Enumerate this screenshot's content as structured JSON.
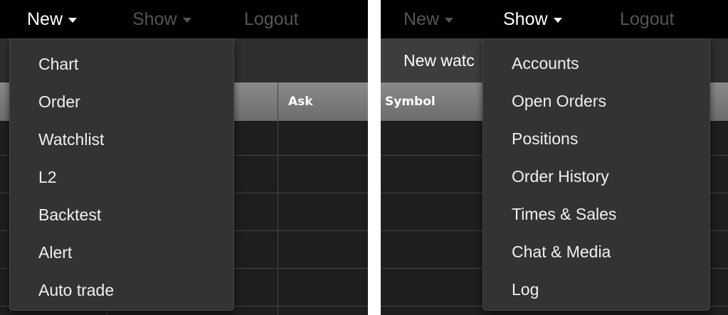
{
  "left_panel": {
    "nav": {
      "new": "New",
      "show": "Show",
      "logout": "Logout"
    },
    "table_header": {
      "ask": "Ask"
    },
    "new_menu": [
      "Chart",
      "Order",
      "Watchlist",
      "L2",
      "Backtest",
      "Alert",
      "Auto trade"
    ]
  },
  "right_panel": {
    "nav": {
      "new": "New",
      "show": "Show",
      "logout": "Logout"
    },
    "tab_label": "New watc",
    "table_header": {
      "symbol": "Symbol"
    },
    "show_menu": [
      "Accounts",
      "Open Orders",
      "Positions",
      "Order History",
      "Times & Sales",
      "Chat & Media",
      "Log"
    ]
  },
  "colors": {
    "background": "#222222",
    "menu": "#333333",
    "navbar": "#000000"
  }
}
